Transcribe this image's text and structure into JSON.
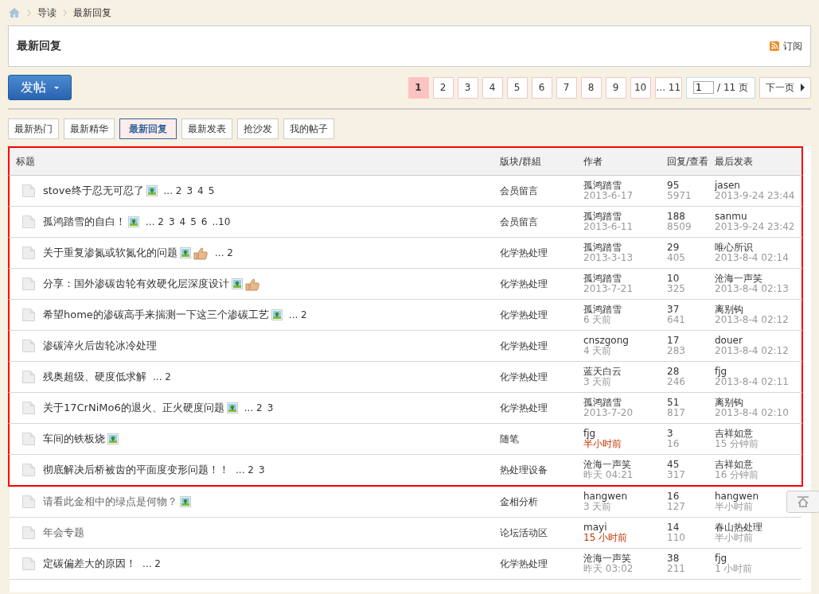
{
  "breadcrumb": [
    "导读",
    "最新回复"
  ],
  "header": {
    "title": "最新回复",
    "subscribe": "订阅"
  },
  "post_button": {
    "label": "发帖"
  },
  "pagination": {
    "pages": [
      {
        "label": "1",
        "selected": true
      },
      {
        "label": "2",
        "selected": false
      },
      {
        "label": "3",
        "selected": false
      },
      {
        "label": "4",
        "selected": false
      },
      {
        "label": "5",
        "selected": false
      },
      {
        "label": "6",
        "selected": false
      },
      {
        "label": "7",
        "selected": false
      },
      {
        "label": "8",
        "selected": false
      },
      {
        "label": "9",
        "selected": false
      },
      {
        "label": "10",
        "selected": false
      },
      {
        "label": "... 11",
        "selected": false
      }
    ],
    "page_input": "1",
    "total": "/ 11 页",
    "next": "下一页"
  },
  "tabs": [
    {
      "label": "最新热门",
      "selected": false
    },
    {
      "label": "最新精华",
      "selected": false
    },
    {
      "label": "最新回复",
      "selected": true
    },
    {
      "label": "最新发表",
      "selected": false
    },
    {
      "label": "抢沙发",
      "selected": false
    },
    {
      "label": "我的帖子",
      "selected": false
    }
  ],
  "table": {
    "columns": [
      "标题",
      "版块/群組",
      "作者",
      "回复/查看",
      "最后发表"
    ],
    "rows": [
      {
        "title": "stove终于忍无可忍了",
        "has_image": true,
        "has_thumb": false,
        "pages": [
          "... 2",
          "3",
          "4",
          "5"
        ],
        "forum": "会员留言",
        "author": "孤鸿踏雪",
        "author_time": "2013-6-17",
        "author_time_recent": false,
        "replies": "95",
        "views": "5971",
        "last_user": "jasen",
        "last_time": "2013-9-24 23:44",
        "dimmed": false,
        "highlighted": true
      },
      {
        "title": "孤鸿踏雪的自白！",
        "has_image": true,
        "has_thumb": false,
        "pages": [
          "... 2",
          "3",
          "4",
          "5",
          "6",
          "..10"
        ],
        "forum": "会员留言",
        "author": "孤鸿踏雪",
        "author_time": "2013-6-11",
        "author_time_recent": false,
        "replies": "188",
        "views": "8509",
        "last_user": "sanmu",
        "last_time": "2013-9-24 23:42",
        "dimmed": false,
        "highlighted": true
      },
      {
        "title": "关于重复渗氮或软氮化的问题",
        "has_image": true,
        "has_thumb": true,
        "pages": [
          "... 2"
        ],
        "forum": "化学热处理",
        "author": "孤鸿踏雪",
        "author_time": "2013-3-13",
        "author_time_recent": false,
        "replies": "29",
        "views": "405",
        "last_user": "唯心所识",
        "last_time": "2013-8-4 02:14",
        "dimmed": false,
        "highlighted": true
      },
      {
        "title": "分享：国外渗碳齿轮有效硬化层深度设计",
        "has_image": true,
        "has_thumb": true,
        "pages": [],
        "forum": "化学热处理",
        "author": "孤鸿踏雪",
        "author_time": "2013-7-21",
        "author_time_recent": false,
        "replies": "10",
        "views": "325",
        "last_user": "沧海一声笑",
        "last_time": "2013-8-4 02:13",
        "dimmed": false,
        "highlighted": true
      },
      {
        "title": "希望home的渗碳高手来揣测一下这三个渗碳工艺",
        "has_image": true,
        "has_thumb": false,
        "pages": [
          "... 2"
        ],
        "forum": "化学热处理",
        "author": "孤鸿踏雪",
        "author_time": "6 天前",
        "author_time_recent": false,
        "replies": "37",
        "views": "641",
        "last_user": "离别钩",
        "last_time": "2013-8-4 02:12",
        "dimmed": false,
        "highlighted": true
      },
      {
        "title": "渗碳淬火后齿轮冰冷处理",
        "has_image": false,
        "has_thumb": false,
        "pages": [],
        "forum": "化学热处理",
        "author": "cnszgong",
        "author_time": "4 天前",
        "author_time_recent": false,
        "replies": "17",
        "views": "283",
        "last_user": "douer",
        "last_time": "2013-8-4 02:12",
        "dimmed": false,
        "highlighted": true
      },
      {
        "title": "残奥超级、硬度低求解",
        "has_image": false,
        "has_thumb": false,
        "pages": [
          "... 2"
        ],
        "forum": "化学热处理",
        "author": "蓝天白云",
        "author_time": "3 天前",
        "author_time_recent": false,
        "replies": "28",
        "views": "246",
        "last_user": "fjg",
        "last_time": "2013-8-4 02:11",
        "dimmed": false,
        "highlighted": true
      },
      {
        "title": "关于17CrNiMo6的退火、正火硬度问题",
        "has_image": true,
        "has_thumb": false,
        "pages": [
          "... 2",
          "3"
        ],
        "forum": "化学热处理",
        "author": "孤鸿踏雪",
        "author_time": "2013-7-20",
        "author_time_recent": false,
        "replies": "51",
        "views": "817",
        "last_user": "离别钩",
        "last_time": "2013-8-4 02:10",
        "dimmed": false,
        "highlighted": true
      },
      {
        "title": "车间的铁板烧",
        "has_image": true,
        "has_thumb": false,
        "pages": [],
        "forum": "随笔",
        "author": "fjg",
        "author_time": "半小时前",
        "author_time_recent": true,
        "replies": "3",
        "views": "16",
        "last_user": "吉祥如意",
        "last_time": "15 分钟前",
        "dimmed": false,
        "highlighted": true
      },
      {
        "title": "彻底解决后桥被齿的平面度变形问题！！",
        "has_image": false,
        "has_thumb": false,
        "pages": [
          "... 2",
          "3"
        ],
        "forum": "热处理设备",
        "author": "沧海一声笑",
        "author_time": "昨天 04:21",
        "author_time_recent": false,
        "replies": "45",
        "views": "317",
        "last_user": "吉祥如意",
        "last_time": "16 分钟前",
        "dimmed": false,
        "highlighted": true
      },
      {
        "title": "请看此金相中的绿点是何物？",
        "has_image": true,
        "has_thumb": false,
        "pages": [],
        "forum": "金相分析",
        "author": "hangwen",
        "author_time": "3 天前",
        "author_time_recent": false,
        "replies": "16",
        "views": "127",
        "last_user": "hangwen",
        "last_time": "半小时前",
        "dimmed": true,
        "highlighted": false
      },
      {
        "title": "年会专题",
        "has_image": false,
        "has_thumb": false,
        "pages": [],
        "forum": "论坛活动区",
        "author": "mayi",
        "author_time": "15 小时前",
        "author_time_recent": true,
        "replies": "14",
        "views": "110",
        "last_user": "春山热处理",
        "last_time": "半小时前",
        "dimmed": true,
        "highlighted": false
      },
      {
        "title": "定碳偏差大的原因！",
        "has_image": false,
        "has_thumb": false,
        "pages": [
          "... 2"
        ],
        "forum": "化学热处理",
        "author": "沧海一声笑",
        "author_time": "昨天 03:02",
        "author_time_recent": false,
        "replies": "38",
        "views": "211",
        "last_user": "fjg",
        "last_time": "1 小时前",
        "dimmed": false,
        "highlighted": false
      }
    ]
  }
}
